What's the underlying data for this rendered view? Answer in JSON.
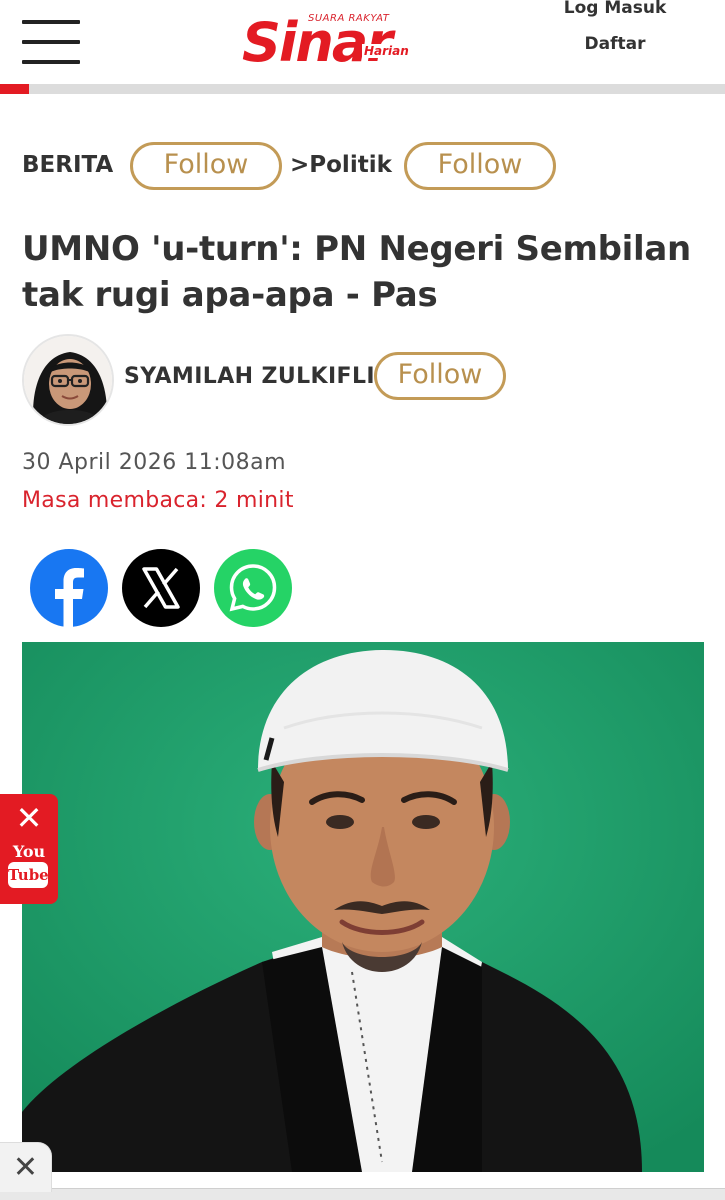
{
  "header": {
    "logo_brand": "Sinar",
    "logo_tagline": "SUARA RAKYAT",
    "logo_sub": "Harian",
    "login": "Log Masuk",
    "register": "Daftar",
    "brand_color": "#e31b23",
    "read_progress": 0.04
  },
  "breadcrumb": {
    "section": "BERITA",
    "section_follow": "Follow",
    "subsection": ">Politik",
    "subsection_follow": "Follow"
  },
  "article": {
    "headline": "UMNO 'u-turn': PN Negeri Sembilan tak rugi apa-apa - Pas",
    "author": "SYAMILAH ZULKIFLI",
    "author_follow": "Follow",
    "date": "30 April 2026 11:08am",
    "reading_time": "Masa membaca: 2 minit"
  },
  "share": {
    "icons": [
      "facebook-icon",
      "x-icon",
      "whatsapp-icon"
    ]
  },
  "floating": {
    "youtube_you": "You",
    "youtube_tube": "Tube",
    "youtube_close": "✕",
    "ad_close": "✕"
  },
  "colors": {
    "accent_gold": "#c39b57",
    "text_red": "#d9232d",
    "photo_bg": "#1fa06b"
  }
}
